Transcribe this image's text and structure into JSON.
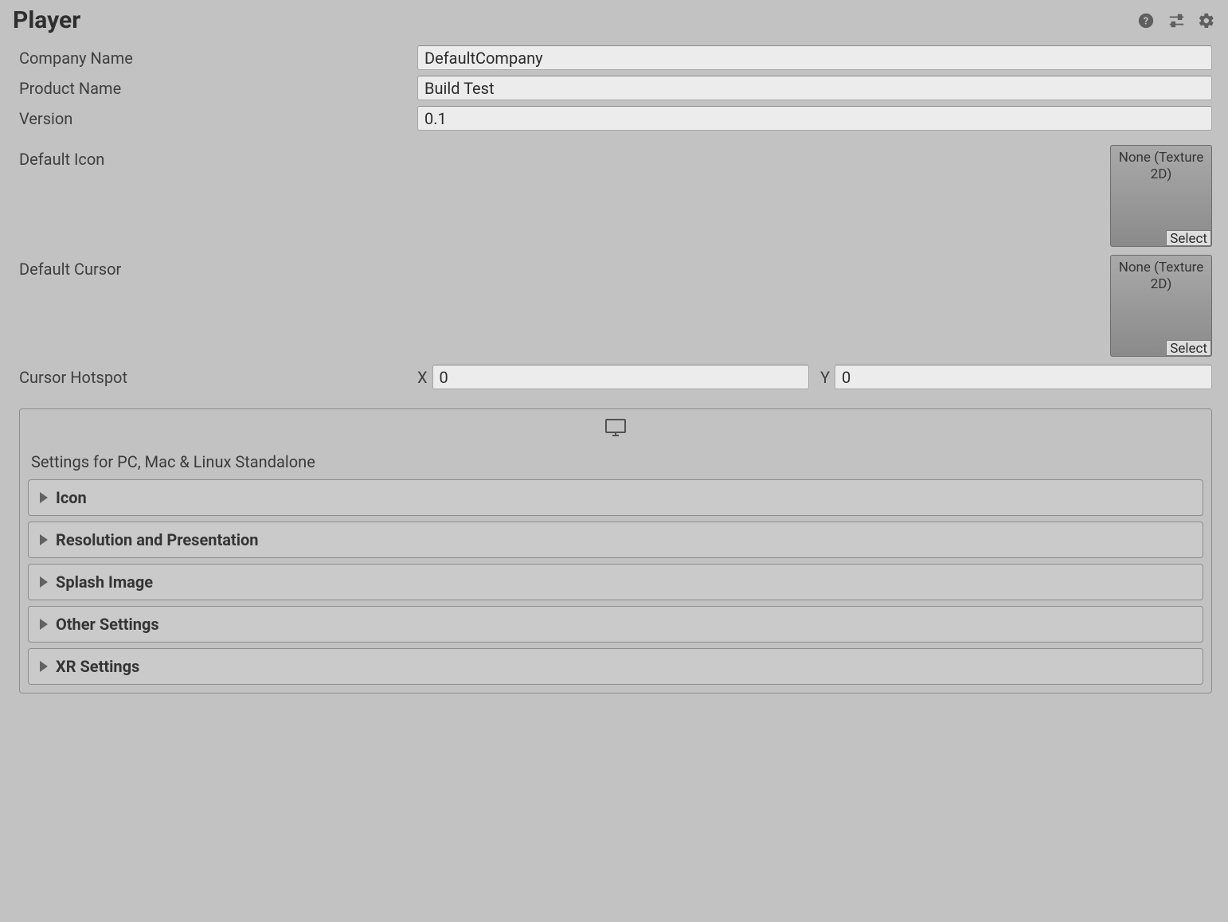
{
  "header": {
    "title": "Player"
  },
  "fields": {
    "companyName": {
      "label": "Company Name",
      "value": "DefaultCompany"
    },
    "productName": {
      "label": "Product Name",
      "value": "Build Test"
    },
    "version": {
      "label": "Version",
      "value": "0.1"
    },
    "defaultIcon": {
      "label": "Default Icon",
      "placeholder": "None (Texture 2D)",
      "selectLabel": "Select"
    },
    "defaultCursor": {
      "label": "Default Cursor",
      "placeholder": "None (Texture 2D)",
      "selectLabel": "Select"
    },
    "cursorHotspot": {
      "label": "Cursor Hotspot",
      "xLabel": "X",
      "x": "0",
      "yLabel": "Y",
      "y": "0"
    }
  },
  "platform": {
    "title": "Settings for PC, Mac & Linux Standalone",
    "foldouts": [
      {
        "label": "Icon"
      },
      {
        "label": "Resolution and Presentation"
      },
      {
        "label": "Splash Image"
      },
      {
        "label": "Other Settings"
      },
      {
        "label": "XR Settings"
      }
    ]
  }
}
